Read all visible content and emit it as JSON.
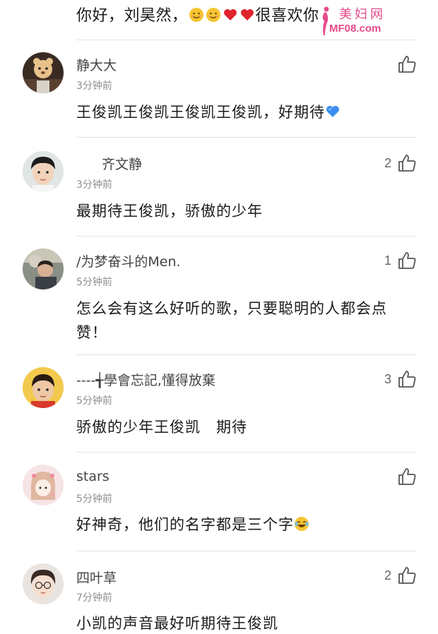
{
  "top_comment": {
    "text_before": "你好，刘昊然，",
    "emojis": [
      "smile-emoji",
      "smile-emoji",
      "heart-emoji",
      "heart-emoji"
    ],
    "text_after": "很喜欢你"
  },
  "watermark": {
    "title": "美妇网",
    "url": "MF08.com",
    "color": "#e64b8c"
  },
  "comments": [
    {
      "username": "静大大",
      "time": "3分钟前",
      "content": "王俊凯王俊凯王俊凯王俊凯，好期待",
      "likes": "",
      "emoji": "blue-heart-emoji"
    },
    {
      "username": "齐文静",
      "time": "3分钟前",
      "content": "最期待王俊凯，骄傲的少年",
      "likes": "2",
      "emoji": ""
    },
    {
      "username": "/为梦奋斗的Men.",
      "time": "5分钟前",
      "content": "怎么会有这么好听的歌，只要聪明的人都会点赞！",
      "likes": "1",
      "emoji": ""
    },
    {
      "username": "----╅學會忘記,懂得放棄",
      "time": "5分钟前",
      "content": "骄傲的少年王俊凯　期待",
      "likes": "3",
      "emoji": ""
    },
    {
      "username": "stars",
      "time": "5分钟前",
      "content": "好神奇，他们的名字都是三个字",
      "likes": "",
      "emoji": "laughing-tears-emoji"
    },
    {
      "username": "四叶草",
      "time": "7分钟前",
      "content": "小凯的声音最好听期待王俊凯",
      "likes": "2",
      "emoji": ""
    }
  ],
  "colors": {
    "text": "#1a1a1a",
    "username": "#444444",
    "time": "#8e8e8e",
    "divider": "#e2e2e2",
    "heart": "#e0242e",
    "blue_heart": "#3b8ff0"
  }
}
